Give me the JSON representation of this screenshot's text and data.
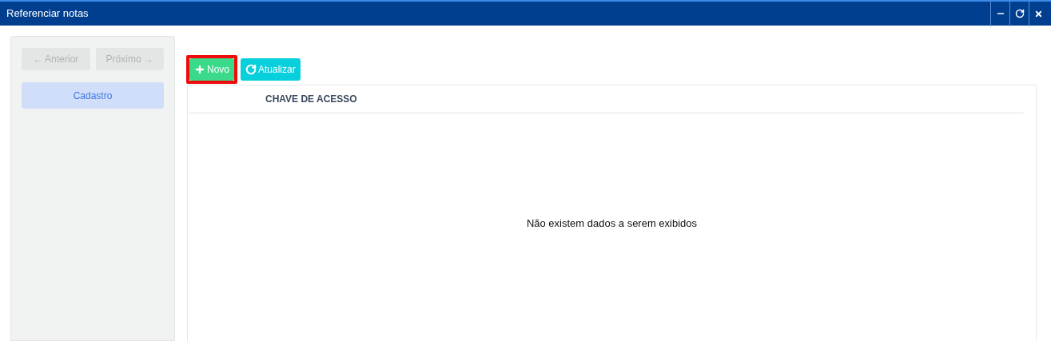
{
  "window": {
    "title": "Referenciar notas",
    "controls": [
      {
        "kind": "minimize"
      },
      {
        "kind": "restore"
      },
      {
        "kind": "close"
      }
    ]
  },
  "sidebar": {
    "nav": [
      {
        "label": "← Anterior",
        "disabled": true
      },
      {
        "label": "Próximo →",
        "disabled": true
      }
    ],
    "items": [
      {
        "label": "Cadastro",
        "selected": true
      }
    ]
  },
  "toolbar": [
    {
      "kind": "add",
      "label": "Novo",
      "highlighted": true
    },
    {
      "kind": "refresh",
      "label": "Atualizar",
      "highlighted": false
    }
  ],
  "table": {
    "columns": [
      "CHAVE DE ACESSO"
    ],
    "empty_message": "Não existem dados a serem exibidos"
  }
}
